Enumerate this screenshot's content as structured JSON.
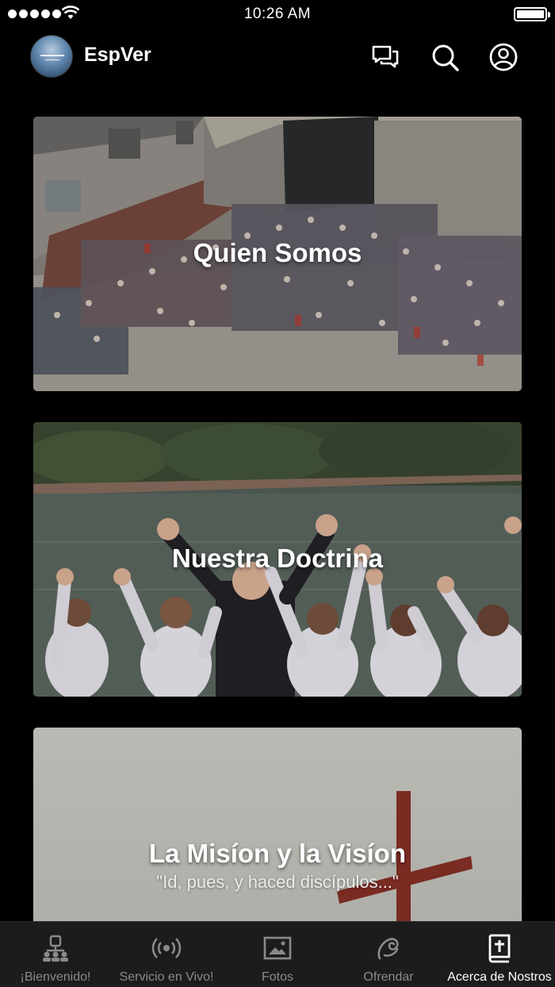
{
  "status_bar": {
    "time": "10:26 AM"
  },
  "header": {
    "title": "EspVer",
    "icons": [
      "chat-icon",
      "search-icon",
      "profile-icon"
    ]
  },
  "cards": [
    {
      "title": "Quien Somos",
      "subtitle": ""
    },
    {
      "title": "Nuestra Doctrina",
      "subtitle": ""
    },
    {
      "title": "La Misíon y la Visíon",
      "subtitle": "\"Id, pues, y haced discípulos...\""
    }
  ],
  "tabbar": {
    "tabs": [
      {
        "label": "¡Bienvenido!",
        "icon": "people-icon",
        "active": false
      },
      {
        "label": "Servicio en Vivo!",
        "icon": "broadcast-icon",
        "active": false
      },
      {
        "label": "Fotos",
        "icon": "photo-icon",
        "active": false
      },
      {
        "label": "Ofrendar",
        "icon": "offering-icon",
        "active": false
      },
      {
        "label": "Acerca de Nostros",
        "icon": "bible-icon",
        "active": true
      }
    ]
  },
  "colors": {
    "background": "#000000",
    "tabbar": "#1c1c1c",
    "inactive": "#8a8a8a",
    "active": "#ffffff"
  }
}
